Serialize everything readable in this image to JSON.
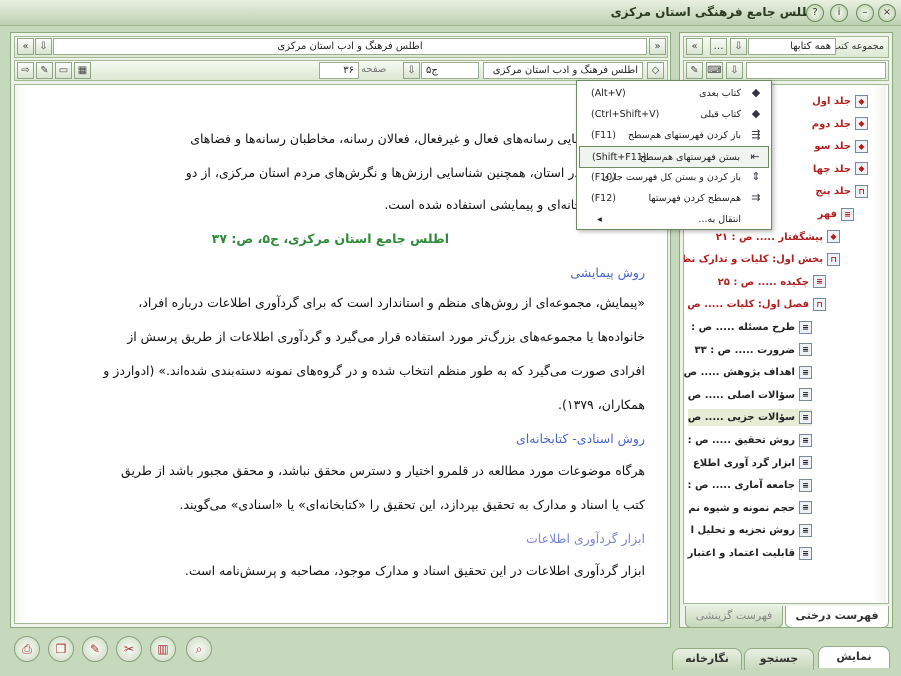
{
  "window": {
    "title": "اطلس جامع فرهنگی استان مرکزی"
  },
  "left": {
    "nav_title": "اطلس فرهنگ و ادب استان مرکزی",
    "book_field": "اطلس فرهنگ و ادب استان مرکزی",
    "volume_value": "ج۵",
    "page_label": "صفحه",
    "page_value": "۳۶",
    "lines": [
      "ی برای شناسایی رسانه‌های فعال و غیرفعال، فعالان رسانه، مخاطبان رسانه‌ها و فضاهای",
      "بط با رسانه در استان، همچنین شناسایی ارزش‌ها و نگرش‌های مردم استان مرکزی، از دو",
      "اسنادی- کتابخانه‌ای و پیمایشی استفاده شده است."
    ],
    "citation": "اطلس جامع استان مرکزی، ج۵، ص: ۳۷",
    "heading1": "روش پیمایشی",
    "para1": [
      "«پیمایش، مجموعه‌ای از روش‌های منظم و استاندارد است که برای گردآوری اطلاعات درباره افراد،",
      "خانواده‌ها یا مجموعه‌های بزرگ‌تر مورد استفاده قرار می‌گیرد و گردآوری اطلاعات از طریق پرسش از",
      "افرادی صورت می‌گیرد که به طور منظم انتخاب شده و در گروه‌های نمونه دسته‌بندی شده‌اند.» (ادواردز و",
      "همکاران، ۱۳۷۹)."
    ],
    "heading2": "روش اسنادی- کتابخانه‌ای",
    "para2": [
      "هرگاه موضوعات مورد مطالعه در قلمرو اختیار و دسترس محقق نباشد، و محقق مجبور باشد از طریق",
      "کتب یا اسناد و مدارک به تحقیق بپردازد، این تحقیق را «کتابخانه‌ای» یا «اسنادی» می‌گویند."
    ],
    "heading3": "ابزار گردآوری اطلاعات",
    "para3": [
      "ابزار گردآوری اطلاعات در این تحقیق اسناد و مدارک موجود، مصاحبه و پرسش‌نامه است."
    ]
  },
  "right": {
    "collection_label": "مجموعه کتب",
    "collection_value": "همه کتابها",
    "tree": [
      {
        "label": "جلد اول",
        "style": "red",
        "icon": "book-icon"
      },
      {
        "label": "جلد دوم",
        "style": "red",
        "icon": "book-icon"
      },
      {
        "label": "جلد سو",
        "style": "red",
        "icon": "book-icon"
      },
      {
        "label": "جلد چها",
        "style": "red",
        "icon": "book-icon"
      },
      {
        "label": "جلد پنج",
        "style": "red",
        "icon": "book-open-icon"
      },
      {
        "label": "فهر",
        "style": "red",
        "icon": "page-icon"
      },
      {
        "label": "پیشگفتار ..... ص : ۲۱",
        "style": "red",
        "icon": "book-icon"
      },
      {
        "label": "بخش اول: کلیات و تدارک نظ",
        "style": "red",
        "icon": "book-open-icon"
      },
      {
        "label": "چکیده ..... ص : ۲۵",
        "style": "red",
        "icon": "page-icon"
      },
      {
        "label": "فصل اول: کلیات ..... ص",
        "style": "red",
        "icon": "book-open-icon"
      },
      {
        "label": "طرح مسئله ..... ص :",
        "style": "dark",
        "icon": "page-icon"
      },
      {
        "label": "ضرورت ..... ص : ۳۳",
        "style": "dark",
        "icon": "page-icon"
      },
      {
        "label": "اهداف پژوهش ..... ص",
        "style": "dark",
        "icon": "page-icon"
      },
      {
        "label": "سؤالات اصلی ..... ص",
        "style": "dark",
        "icon": "page-icon"
      },
      {
        "label": "سؤالات جزیی ..... ص",
        "style": "dark",
        "icon": "page-icon"
      },
      {
        "label": "روش تحقیق ..... ص :",
        "style": "dark",
        "icon": "page-icon"
      },
      {
        "label": "ابزار گرد آوری اطلاع",
        "style": "dark",
        "icon": "page-icon"
      },
      {
        "label": "جامعه آماری ..... ص :",
        "style": "dark",
        "icon": "page-icon"
      },
      {
        "label": "حجم نمونه و شیوه نم",
        "style": "dark",
        "icon": "page-icon"
      },
      {
        "label": "روش تجزیه و تحلیل ا",
        "style": "dark",
        "icon": "page-icon"
      },
      {
        "label": "قابلیت اعتماد و اعتبار",
        "style": "dark",
        "icon": "page-icon"
      }
    ],
    "tabs": {
      "tree": "فهرست درختی",
      "history": "فهرست گزینشی"
    }
  },
  "menu": [
    {
      "label": "کتاب بعدی",
      "shortcut": "(Alt+V)",
      "icon": "next-book-icon"
    },
    {
      "label": "کتاب قبلی",
      "shortcut": "(Ctrl+Shift+V)",
      "icon": "prev-book-icon"
    },
    {
      "label": "باز کردن فهرستهای هم‌سطح",
      "shortcut": "(F11)",
      "icon": "expand-level-icon"
    },
    {
      "label": "بستن فهرستهای هم‌سطح",
      "shortcut": "(Shift+F11)",
      "icon": "collapse-level-icon"
    },
    {
      "label": "باز کردن و بستن کل فهرست جاری",
      "shortcut": "(F10)",
      "icon": "toggle-all-icon"
    },
    {
      "label": "هم‌سطح کردن فهرستها",
      "shortcut": "(F12)",
      "icon": "align-levels-icon"
    },
    {
      "label": "انتقال به...",
      "shortcut": "",
      "icon": "move-to-icon"
    }
  ],
  "bottom_tabs": {
    "display": "نمایش",
    "search": "جستجو",
    "notes": "نگارخانه"
  }
}
